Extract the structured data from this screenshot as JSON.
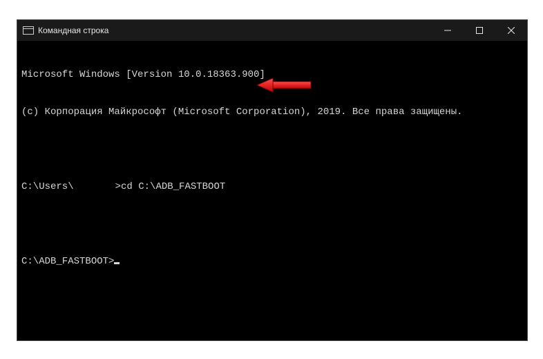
{
  "window": {
    "title": "Командная строка",
    "controls": {
      "minimize": "minimize",
      "maximize": "maximize",
      "close": "close"
    }
  },
  "terminal": {
    "line1": "Microsoft Windows [Version 10.0.18363.900]",
    "line2": "(c) Корпорация Майкрософт (Microsoft Corporation), 2019. Все права защищены.",
    "blank1": "",
    "prompt1_prefix": "C:\\Users\\",
    "prompt1_suffix": ">",
    "command1": "cd C:\\ADB_FASTBOOT",
    "blank2": "",
    "prompt2": "C:\\ADB_FASTBOOT>",
    "blank3": "",
    "blank4": ""
  },
  "annotation": {
    "arrow_color": "#e11b1b"
  }
}
